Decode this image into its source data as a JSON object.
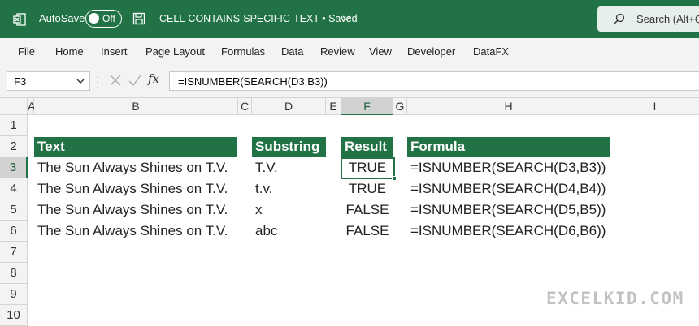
{
  "titlebar": {
    "autosave_label": "AutoSave",
    "autosave_state": "Off",
    "document_title": "CELL-CONTAINS-SPECIFIC-TEXT • Saved",
    "search_placeholder": "Search (Alt+Q)"
  },
  "ribbon": {
    "tabs": [
      "File",
      "Home",
      "Insert",
      "Page Layout",
      "Formulas",
      "Data",
      "Review",
      "View",
      "Developer",
      "DataFX"
    ]
  },
  "formula_bar": {
    "name_box": "F3",
    "fx_label": "fx",
    "formula": "=ISNUMBER(SEARCH(D3,B3))"
  },
  "columns": [
    "A",
    "B",
    "C",
    "D",
    "E",
    "F",
    "G",
    "H",
    "I"
  ],
  "rows": [
    "1",
    "2",
    "3",
    "4",
    "5",
    "6",
    "7",
    "8",
    "9",
    "10"
  ],
  "sheet": {
    "headers": {
      "text": "Text",
      "substring": "Substring",
      "result": "Result",
      "formula": "Formula"
    },
    "data": [
      {
        "text": "The Sun Always Shines on T.V.",
        "substring": "T.V.",
        "result": "TRUE",
        "formula": "=ISNUMBER(SEARCH(D3,B3))"
      },
      {
        "text": "The Sun Always Shines on T.V.",
        "substring": "t.v.",
        "result": "TRUE",
        "formula": "=ISNUMBER(SEARCH(D4,B4))"
      },
      {
        "text": "The Sun Always Shines on T.V.",
        "substring": "x",
        "result": "FALSE",
        "formula": "=ISNUMBER(SEARCH(D5,B5))"
      },
      {
        "text": "The Sun Always Shines on T.V.",
        "substring": "abc",
        "result": "FALSE",
        "formula": "=ISNUMBER(SEARCH(D6,B6))"
      }
    ]
  },
  "watermark": "EXCELKID.COM",
  "colors": {
    "excel_green": "#217346",
    "header_fill": "#217346"
  }
}
